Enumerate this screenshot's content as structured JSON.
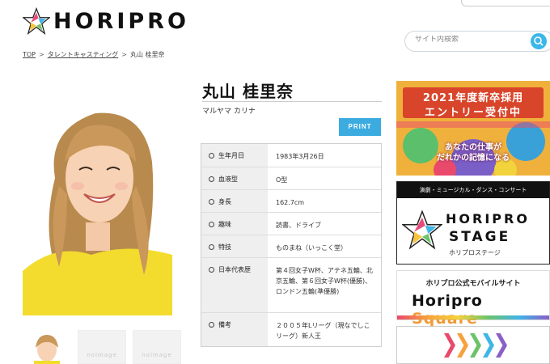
{
  "header": {
    "logo_text": "HORIPRO",
    "search": {
      "placeholder": "サイト内検索"
    }
  },
  "breadcrumb": [
    "TOP",
    "タレントキャスティング",
    "丸山 桂里奈"
  ],
  "profile": {
    "name": "丸山 桂里奈",
    "kana": "マルヤマ カリナ",
    "print_label": "PRINT",
    "rows": [
      {
        "key": "生年月日",
        "value": "1983年3月26日"
      },
      {
        "key": "血液型",
        "value": "O型"
      },
      {
        "key": "身長",
        "value": "162.7cm"
      },
      {
        "key": "趣味",
        "value": "読書、ドライブ"
      },
      {
        "key": "特技",
        "value": "ものまね（いっこく堂）"
      },
      {
        "key": "日本代表歴",
        "value": "第４回女子W杯、アテネ五輪、北京五輪、第６回女子W杯(優勝)、ロンドン五輪(準優勝)"
      },
      {
        "key": "備考",
        "value": "２００５年Lリーグ（現なでしこリーグ）新人王"
      }
    ],
    "thumb_placeholder": "noimage"
  },
  "banners": {
    "recruit": {
      "line1": "2021年度新卒採用",
      "line2": "エントリー受付中",
      "line3": "あなたの仕事が\nだれかの記憶になる"
    },
    "stage": {
      "caption": "演劇・ミュージカル・ダンス・コンサート",
      "word1": "HORIPRO",
      "word2": "STAGE",
      "sub": "ホリプロステージ"
    },
    "square": {
      "title": "ホリプロ公式モバイルサイト",
      "brand": "Horipro",
      "brand2": "Square"
    }
  },
  "colors": {
    "accent": "#3cabe0",
    "search_btn": "#3cb7e8"
  }
}
